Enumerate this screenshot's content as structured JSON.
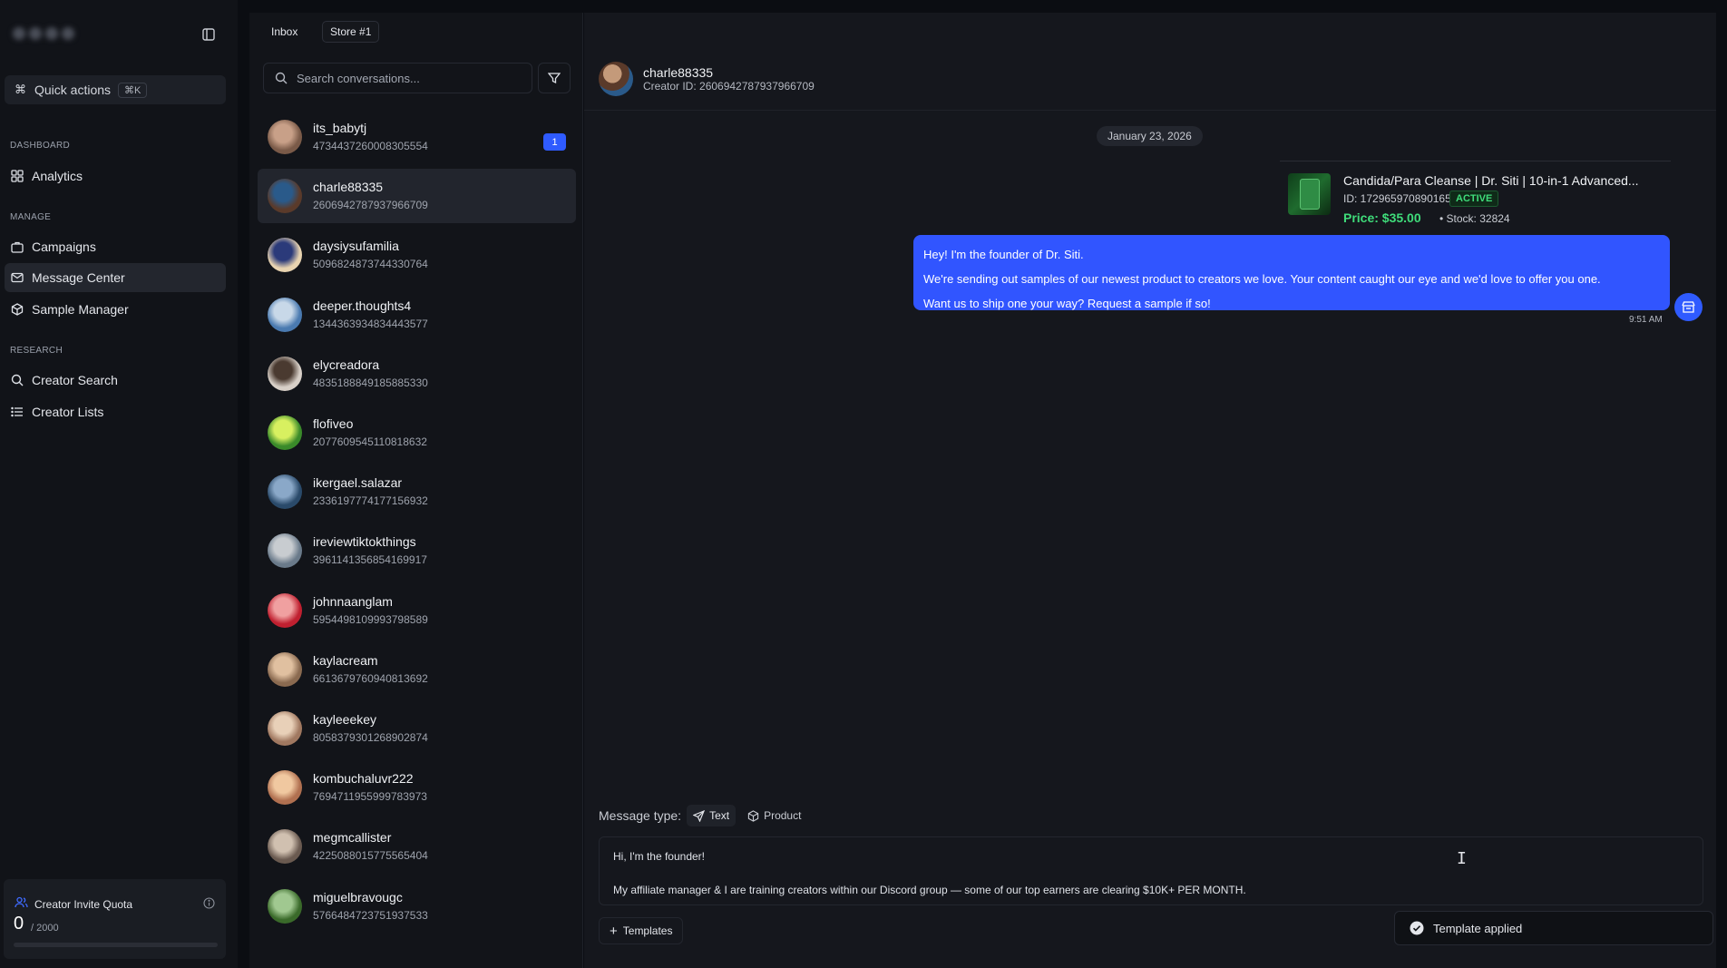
{
  "sidebar": {
    "quick_actions": "Quick actions",
    "quick_shortcut": "⌘K",
    "sections": {
      "dashboard": "DASHBOARD",
      "manage": "MANAGE",
      "research": "RESEARCH"
    },
    "items": {
      "analytics": "Analytics",
      "campaigns": "Campaigns",
      "message_center": "Message Center",
      "sample_manager": "Sample Manager",
      "creator_search": "Creator Search",
      "creator_lists": "Creator Lists"
    },
    "quota": {
      "title": "Creator Invite Quota",
      "used": "0",
      "total": "/ 2000",
      "fraction": 0
    }
  },
  "list": {
    "tabs": [
      "Inbox",
      "Store #1"
    ],
    "search_placeholder": "Search conversations...",
    "conversations": [
      {
        "name": "its_babytj",
        "id": "4734437260008305554",
        "unread": "1"
      },
      {
        "name": "charle88335",
        "id": "2606942787937966709"
      },
      {
        "name": "daysiysufamilia",
        "id": "5096824873744330764"
      },
      {
        "name": "deeper.thoughts4",
        "id": "1344363934834443577"
      },
      {
        "name": "elycreadora",
        "id": "4835188849185885330"
      },
      {
        "name": "flofiveo",
        "id": "2077609545110818632"
      },
      {
        "name": "ikergael.salazar",
        "id": "2336197774177156932"
      },
      {
        "name": "ireviewtiktokthings",
        "id": "3961141356854169917"
      },
      {
        "name": "johnnaanglam",
        "id": "5954498109993798589"
      },
      {
        "name": "kaylacream",
        "id": "6613679760940813692"
      },
      {
        "name": "kayleeekey",
        "id": "8058379301268902874"
      },
      {
        "name": "kombuchaluvr222",
        "id": "7694711955999783973"
      },
      {
        "name": "megmcallister",
        "id": "4225088015775565404"
      },
      {
        "name": "miguelbravougc",
        "id": "5766484723751937533"
      }
    ]
  },
  "chat": {
    "name": "charle88335",
    "creator_id": "Creator ID: 2606942787937966709",
    "date": "January 23, 2026",
    "product": {
      "title": "Candida/Para Cleanse | Dr. Siti | 10-in-1 Advanced...",
      "id": "ID: 1729659708901658822",
      "status": "ACTIVE",
      "price": "Price: $35.00",
      "stock": "• Stock: 32824"
    },
    "message": {
      "line1": "Hey! I'm the founder of Dr. Siti.",
      "line2": "We're sending out samples of our newest product to creators we love. Your content caught our eye and we'd love to offer you one.",
      "line3": "Want us to ship one your way? Request a sample if so!",
      "time": "9:51 AM"
    },
    "message_type_label": "Message type:",
    "type_text": "Text",
    "type_product": "Product",
    "composer": {
      "line1": "Hi, I'm the founder!",
      "line2": "My affiliate manager & I are training creators within our Discord group — some of our top earners are clearing $10K+ PER MONTH."
    },
    "templates": "Templates",
    "toast": "Template applied"
  }
}
